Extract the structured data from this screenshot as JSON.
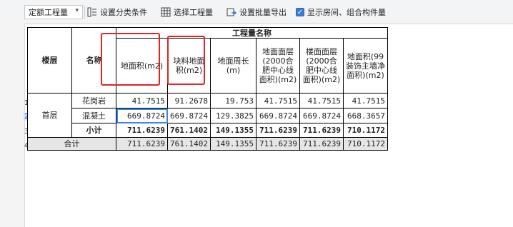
{
  "toolbar": {
    "dropdown_value": "定额工程量",
    "set_category_label": "设置分类条件",
    "select_quantity_label": "选择工程量",
    "batch_export_label": "设置批量导出",
    "show_rooms_label": "显示房间、组合构件量",
    "show_rooms_checked": true
  },
  "table": {
    "group_header": "工程量名称",
    "floor_header": "楼层",
    "name_header": "名称",
    "columns": [
      "地面积(m2)",
      "块料地面积(m2)",
      "地面周长(m)",
      "地面面层(2000合肥中心线面积)(m2)",
      "楼面面层(2000合肥中心线面积)(m2)",
      "地面积(99装饰主墙净面积)(m2)"
    ],
    "floor_name": "首层",
    "rows": [
      {
        "num": "1",
        "name": "花岗岩",
        "values": [
          "41.7515",
          "91.2678",
          "19.753",
          "41.7515",
          "41.7515",
          "41.7515"
        ]
      },
      {
        "num": "2",
        "name": "混凝土",
        "values": [
          "669.8724",
          "669.8724",
          "129.3825",
          "669.8724",
          "669.8724",
          "668.3657"
        ]
      },
      {
        "num": "3",
        "name": "小计",
        "values": [
          "711.6239",
          "761.1402",
          "149.1355",
          "711.6239",
          "711.6239",
          "710.1172"
        ]
      }
    ],
    "total": {
      "num": "4",
      "label": "合计",
      "values": [
        "711.6239",
        "761.1402",
        "149.1355",
        "711.6239",
        "711.6239",
        "710.1172"
      ]
    }
  }
}
